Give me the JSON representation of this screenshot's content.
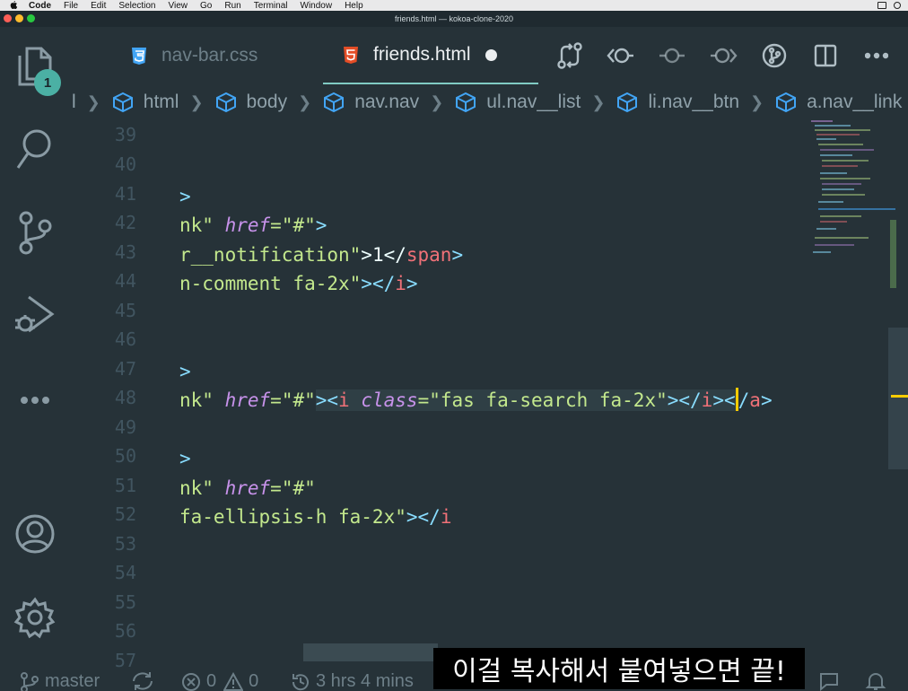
{
  "menubar": {
    "app": "Code",
    "items": [
      "File",
      "Edit",
      "Selection",
      "View",
      "Go",
      "Run",
      "Terminal",
      "Window",
      "Help"
    ]
  },
  "window": {
    "title": "friends.html — kokoa-clone-2020"
  },
  "activity": {
    "explorer_badge": "1"
  },
  "tabs": [
    {
      "label": "nav-bar.css",
      "icon": "css3-icon",
      "active": false
    },
    {
      "label": "friends.html",
      "icon": "html5-icon",
      "active": true,
      "dirty": true
    }
  ],
  "breadcrumbs": [
    "l",
    "html",
    "body",
    "nav.nav",
    "ul.nav__list",
    "li.nav__btn",
    "a.nav__link"
  ],
  "editor": {
    "line_numbers": [
      "39",
      "40",
      "41",
      "42",
      "43",
      "44",
      "45",
      "46",
      "47",
      "48",
      "49",
      "50",
      "51",
      "52",
      "53",
      "54",
      "55",
      "56",
      "57"
    ]
  },
  "code": {
    "l41": {
      "a": ">"
    },
    "l42": {
      "a": "nk\"",
      "b": "href",
      "c": "=\"#\"",
      "d": ">"
    },
    "l43": {
      "a": "r__notification\"",
      "b": ">1</",
      "c": "span",
      "d": ">"
    },
    "l44": {
      "a": "n-comment fa-2x\"",
      "b": "></",
      "c": "i",
      "d": ">"
    },
    "l47": {
      "a": ">"
    },
    "l48": {
      "a": "nk\"",
      "b": "href",
      "c": "=\"#\"",
      "d": "><",
      "e": "i",
      "f": "class",
      "g": "=\"fas fa-search fa-2x\"",
      "h": "></",
      "i": "i",
      "j": "><",
      "k": "/",
      "l": "a",
      "m": ">"
    },
    "l50": {
      "a": ">"
    },
    "l51": {
      "a": "nk\"",
      "b": "href",
      "c": "=\"#\""
    },
    "l52": {
      "a": "fa-ellipsis-h fa-2x\"",
      "b": "></",
      "c": "i"
    }
  },
  "status": {
    "branch": "master",
    "errors": "0",
    "warnings": "0",
    "time": "3 hrs 4 mins"
  },
  "subtitle": "이걸 복사해서 붙여넣으면 끝!",
  "colors": {
    "background": "#263238",
    "tag": "#89ddff",
    "tag_name": "#f07178",
    "attribute": "#c792ea",
    "string": "#c3e88d",
    "badge": "#4bb0a4",
    "cursor": "#ffcc00"
  }
}
